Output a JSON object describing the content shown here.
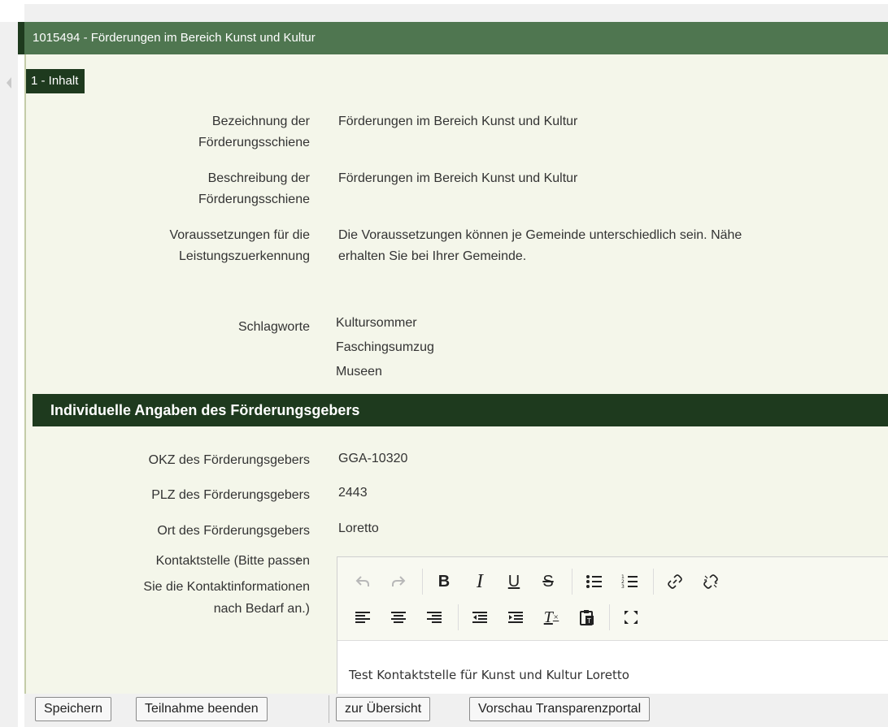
{
  "window": {
    "title": "1015494 - Förderungen im Bereich Kunst und Kultur"
  },
  "section_tab": {
    "label": "1 - Inhalt"
  },
  "fields": [
    {
      "label": "Bezeichnung der Förderungsschiene",
      "value": "Förderungen im Bereich Kunst und Kultur"
    },
    {
      "label": "Beschreibung der Förderungsschiene",
      "value": "Förderungen im Bereich Kunst und Kultur"
    },
    {
      "label": "Voraussetzungen für die Leistungszuerkennung",
      "value_line1": "Die Voraussetzungen können je Gemeinde unterschiedlich sein. Nähe",
      "value_line2": "erhalten Sie bei Ihrer Gemeinde."
    },
    {
      "label": "Schlagworte",
      "values": [
        "Kultursommer",
        "Faschingsumzug",
        "Museen"
      ]
    }
  ],
  "section2": {
    "title": "Individuelle Angaben des Förderungsgebers",
    "fields": [
      {
        "label": "OKZ des Förderungsgebers",
        "value": "GGA-10320"
      },
      {
        "label": "PLZ des Förderungsgebers",
        "value": "2443"
      },
      {
        "label": "Ort des Förderungsgebers",
        "value": "Loretto"
      }
    ],
    "contact": {
      "label_line1": "Kontaktstelle (Bitte passen",
      "label_line2": "Sie die Kontaktinformationen",
      "label_line3": "nach Bedarf an.)",
      "required_mark": "*",
      "editor_text": "Test Kontaktstelle für Kunst und Kultur Loretto"
    }
  },
  "toolbar_icons": [
    "undo-icon",
    "redo-icon",
    "bold-icon",
    "italic-icon",
    "underline-icon",
    "strikethrough-icon",
    "bullet-list-icon",
    "numbered-list-icon",
    "link-icon",
    "unlink-icon",
    "align-left-icon",
    "align-center-icon",
    "align-right-icon",
    "outdent-icon",
    "indent-icon",
    "clear-format-icon",
    "paste-icon",
    "fullscreen-icon"
  ],
  "buttons": {
    "save": "Speichern",
    "end_participation": "Teilnahme beenden",
    "overview": "zur Übersicht",
    "preview": "Vorschau Transparenzportal"
  },
  "colors": {
    "header": "#4f7650",
    "dark_green": "#1e3a1e",
    "background": "#f4f6ea"
  }
}
